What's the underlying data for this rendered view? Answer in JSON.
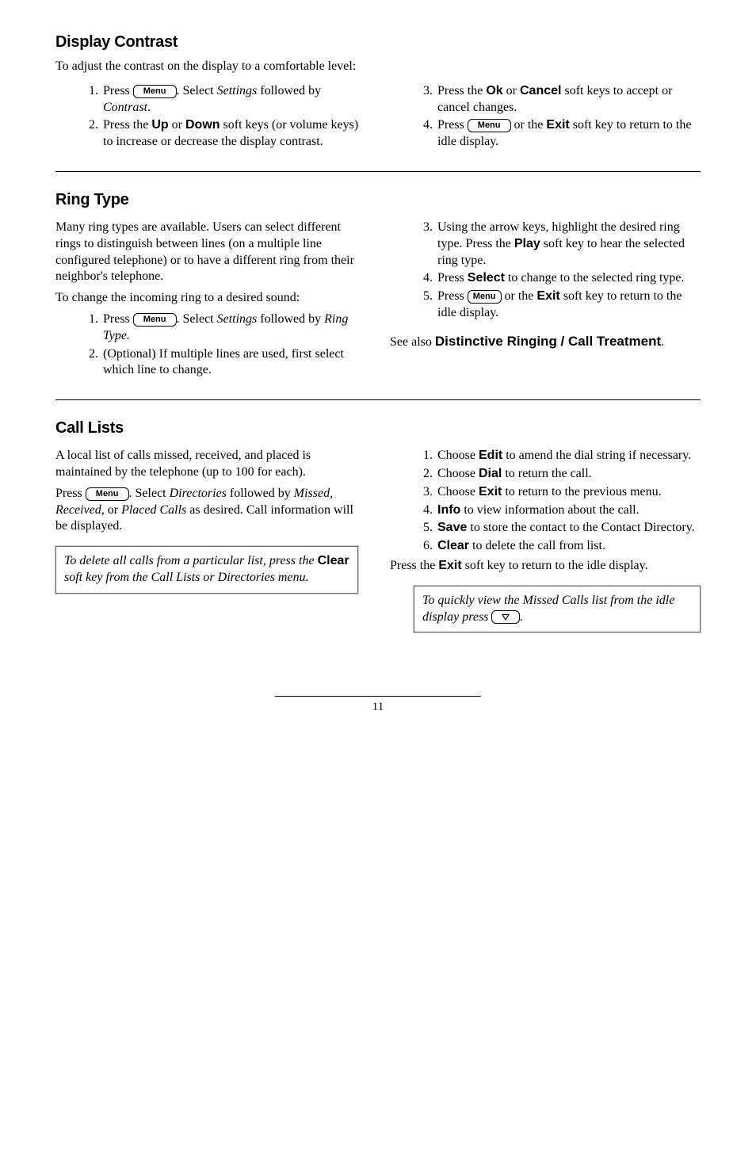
{
  "menu_label": "Menu",
  "s1": {
    "heading": "Display Contrast",
    "intro": "To adjust the contrast on the display to a comfortable level:",
    "l1a": "Press ",
    "l1b": ".  Select ",
    "l1c": "Settings",
    "l1d": " followed by ",
    "l1e": "Contrast",
    "l1f": ".",
    "l2a": "Press the ",
    "l2b": "Up",
    "l2c": " or ",
    "l2d": "Down",
    "l2e": " soft keys (or volume keys) to increase or decrease the display contrast.",
    "r3a": "Press the ",
    "r3b": "Ok",
    "r3c": " or ",
    "r3d": "Cancel",
    "r3e": " soft keys to accept or cancel changes.",
    "r4a": "Press ",
    "r4b": " or the ",
    "r4c": "Exit",
    "r4d": " soft key to return to the idle display."
  },
  "s2": {
    "heading": "Ring Type",
    "intro1": "Many ring types are available.  Users can select different rings to distinguish between lines (on a multiple line configured telephone) or to have a different ring from their neighbor's telephone.",
    "intro2": "To change the incoming ring to a desired sound:",
    "l1a": "Press ",
    "l1b": ".  Select ",
    "l1c": "Settings",
    "l1d": " followed by ",
    "l1e": "Ring Type.",
    "l2": "(Optional)  If multiple lines are used, first select which line to change.",
    "r3a": "Using the arrow keys, highlight the desired ring type.  Press the ",
    "r3b": "Play",
    "r3c": " soft key to hear the selected ring type.",
    "r4a": "Press ",
    "r4b": "Select",
    "r4c": " to change to the selected ring type.",
    "r5a": "Press ",
    "r5b": " or the ",
    "r5c": "Exit",
    "r5d": " soft key to return to the idle display.",
    "see_a": "See also ",
    "see_b": "Distinctive Ringing / Call Treatment",
    "see_c": "."
  },
  "s3": {
    "heading": "Call Lists",
    "intro": "A local list of calls missed, received, and placed is maintained by the telephone (up to 100 for each).",
    "p2a": "Press ",
    "p2b": ".  Select ",
    "p2c": "Directories",
    "p2d": " followed by ",
    "p2e": "Missed, Received,",
    "p2f": " or ",
    "p2g": "Placed Calls",
    "p2h": " as desired.  Call information will be displayed.",
    "note1a": "To delete all calls from a particular list, press the ",
    "note1b": "Clear",
    "note1c": " soft key from the Call Lists or Directories menu.",
    "r1a": "Choose ",
    "r1b": "Edit",
    "r1c": " to amend the dial string if necessary.",
    "r2a": "Choose ",
    "r2b": "Dial",
    "r2c": " to return the call.",
    "r3a": "Choose ",
    "r3b": "Exit",
    "r3c": " to return to the previous menu.",
    "r4a": "Info",
    "r4b": " to view information about the call.",
    "r5a": "Save",
    "r5b": " to store the contact to the Contact Directory.",
    "r6a": "Clear",
    "r6b": " to delete the call from list.",
    "tail_a": "Press the ",
    "tail_b": "Exit",
    "tail_c": " soft key to return to the idle display.",
    "note2a": "To quickly view the Missed Calls list from the idle display press ",
    "note2b": "."
  },
  "page": "11"
}
